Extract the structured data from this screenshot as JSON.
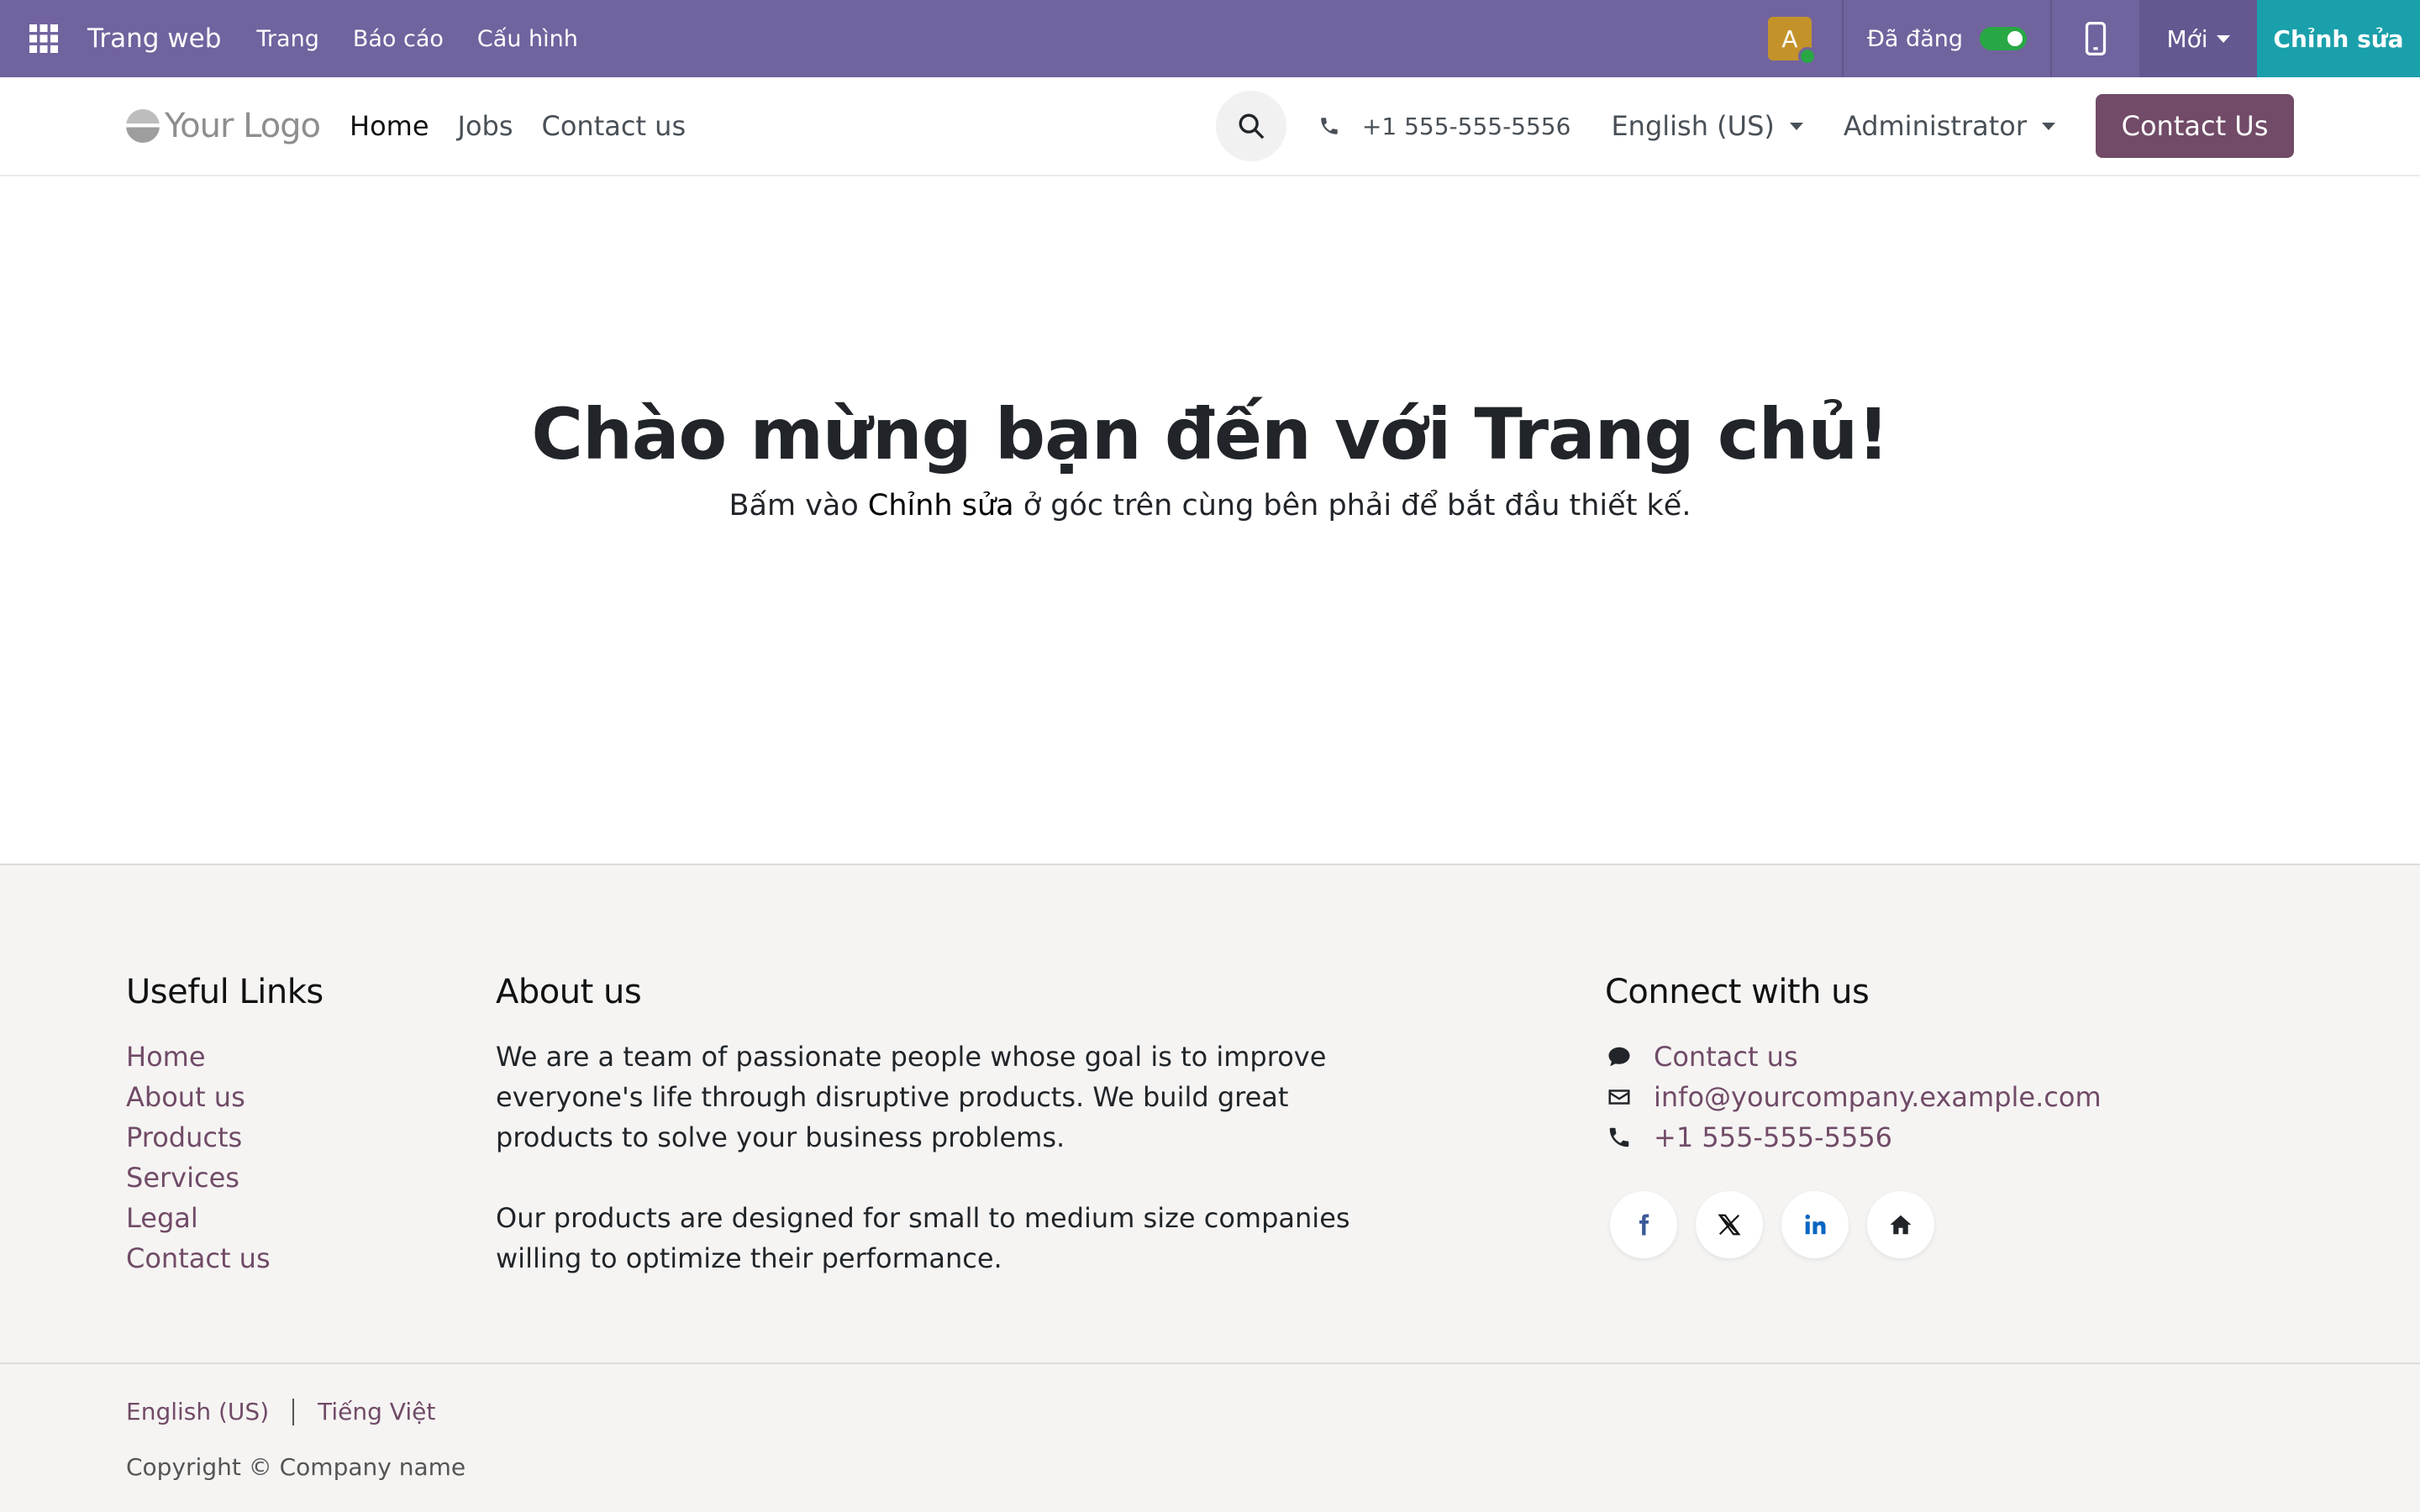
{
  "admin_bar": {
    "brand": "Trang web",
    "menu": [
      "Trang",
      "Báo cáo",
      "Cấu hình"
    ],
    "avatar_initial": "A",
    "published_label": "Đã đăng",
    "published_on": true,
    "new_label": "Mới",
    "edit_label": "Chỉnh sửa",
    "bg_color": "#71639e",
    "edit_color": "#1aa0ab"
  },
  "header": {
    "logo_text": "Your Logo",
    "nav": [
      "Home",
      "Jobs",
      "Contact us"
    ],
    "active_nav": "Home",
    "phone": "+1 555-555-5556",
    "language": "English (US)",
    "user": "Administrator",
    "cta_label": "Contact Us",
    "cta_color": "#714b67"
  },
  "hero": {
    "title_prefix": "Chào mừng bạn đến với ",
    "title_bold": "Trang chủ",
    "title_suffix": "!",
    "sub_prefix": "Bấm vào ",
    "sub_bold": "Chỉnh sửa",
    "sub_suffix": " ở góc trên cùng bên phải để bắt đầu thiết kế."
  },
  "footer": {
    "useful_links": {
      "title": "Useful Links",
      "items": [
        "Home",
        "About us",
        "Products",
        "Services",
        "Legal",
        "Contact us"
      ]
    },
    "about": {
      "title": "About us",
      "paragraphs": [
        "We are a team of passionate people whose goal is to improve everyone's life through disruptive products. We build great products to solve your business problems.",
        "Our products are designed for small to medium size companies willing to optimize their performance."
      ]
    },
    "connect": {
      "title": "Connect with us",
      "items": [
        {
          "icon": "comment-icon",
          "text": "Contact us"
        },
        {
          "icon": "envelope-icon",
          "text": "info@yourcompany.example.com"
        },
        {
          "icon": "phone-icon",
          "text": "+1 555-555-5556"
        }
      ],
      "socials": [
        "facebook-icon",
        "x-twitter-icon",
        "linkedin-icon",
        "home-icon"
      ]
    }
  },
  "copyright": {
    "languages": [
      "English (US)",
      "Tiếng Việt"
    ],
    "text": "Copyright © Company name"
  }
}
